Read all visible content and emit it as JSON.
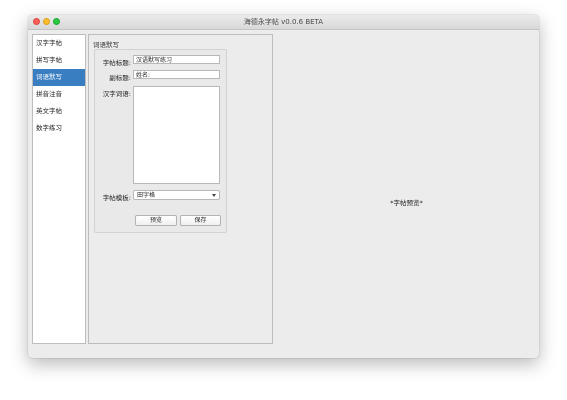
{
  "window": {
    "title": "海德永字帖 v0.0.6 BETA"
  },
  "sidebar": {
    "items": [
      {
        "label": "汉字字帖"
      },
      {
        "label": "拼写字帖"
      },
      {
        "label": "词语默写"
      },
      {
        "label": "拼音注音"
      },
      {
        "label": "英文字帖"
      },
      {
        "label": "数字练习"
      }
    ],
    "active_index": 2
  },
  "editor": {
    "group_title": "词语默写",
    "title_label": "字帖标题:",
    "title_value": "汉语默写练习",
    "subtitle_label": "副标题:",
    "subtitle_value": "姓名: ________",
    "words_label": "汉字词语:",
    "words_value": "",
    "template_label": "字帖模板:",
    "template_value": "田字格",
    "preview_button": "预览",
    "save_button": "保存"
  },
  "preview": {
    "placeholder": "*字帖预览*"
  }
}
